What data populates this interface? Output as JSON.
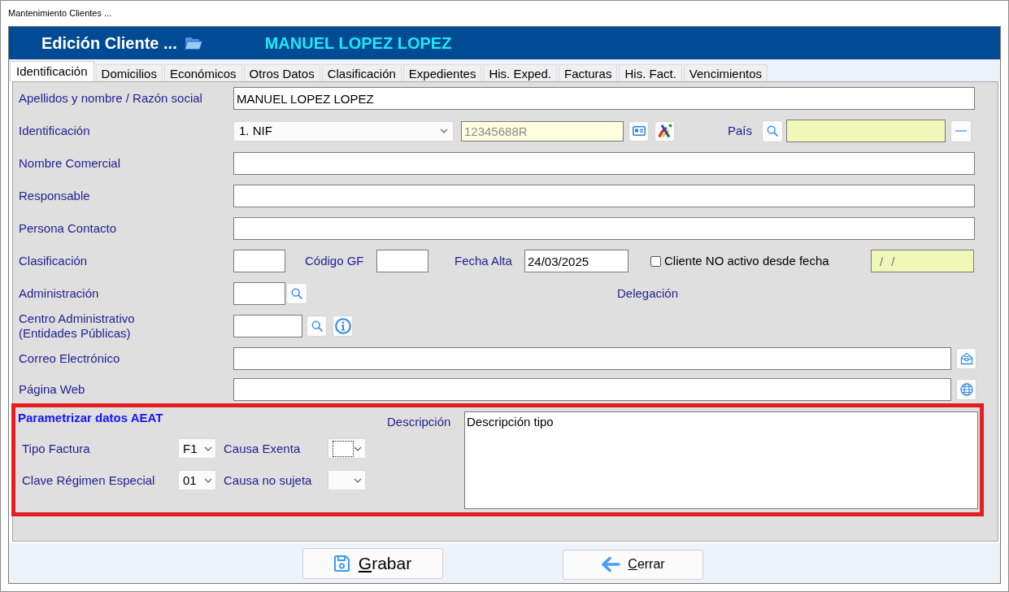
{
  "window": {
    "title": "Mantenimiento Clientes ..."
  },
  "header": {
    "title": "Edición Cliente ...",
    "client_name": "MANUEL LOPEZ LOPEZ"
  },
  "tabs": [
    {
      "label": "Identificación",
      "selected": true
    },
    {
      "label": "Domicilios",
      "selected": false
    },
    {
      "label": "Económicos",
      "selected": false
    },
    {
      "label": "Otros Datos",
      "selected": false
    },
    {
      "label": "Clasificación",
      "selected": false
    },
    {
      "label": "Expedientes",
      "selected": false
    },
    {
      "label": "His. Exped.",
      "selected": false
    },
    {
      "label": "Facturas",
      "selected": false
    },
    {
      "label": "His. Fact.",
      "selected": false
    },
    {
      "label": "Vencimientos",
      "selected": false
    }
  ],
  "rows": [
    {
      "kind": "text",
      "label": "Apellidos y nombre / Razón social",
      "value": "MANUEL LOPEZ LOPEZ"
    },
    {
      "kind": "identification",
      "label": "Identificación",
      "document_type": "1. NIF",
      "number": "12345688R",
      "disabled": true,
      "country_label": "País"
    },
    {
      "kind": "text",
      "label": "Nombre Comercial"
    },
    {
      "kind": "text",
      "label": "Responsable"
    },
    {
      "kind": "text",
      "label": "Persona Contacto"
    },
    {
      "kind": "dates",
      "label": "Clasificación",
      "code_label": "Código GF",
      "date_label": "Fecha Alta",
      "date_value": "24/03/2025",
      "inactive": {
        "label": "Cliente NO activo desde fecha",
        "checked": false,
        "date_value": "/ /"
      }
    },
    {
      "kind": "lookup",
      "label": "Administración",
      "side_label": "Delegación"
    },
    {
      "kind": "lookup_info",
      "label": "Centro Administrativo\n(Entidades Públicas)"
    },
    {
      "kind": "email",
      "label": "Correo Electrónico"
    },
    {
      "kind": "web",
      "label": "Página Web"
    }
  ],
  "aeat": {
    "title": "Parametrizar datos AEAT",
    "params": [
      {
        "label": "Tipo Factura",
        "value": "F1",
        "focused": false
      },
      {
        "label": "Causa Exenta",
        "focused": true
      },
      {
        "label": "Clave Régimen Especial",
        "value": "01",
        "focused": false
      },
      {
        "label": "Causa no sujeta",
        "focused": false
      }
    ],
    "description_label": "Descripción",
    "description": "Descripción tipo"
  },
  "buttons": [
    {
      "kind": "save",
      "label": "Grabar",
      "mnemonic": true
    },
    {
      "kind": "close",
      "label": "Cerrar",
      "mnemonic": true
    }
  ]
}
